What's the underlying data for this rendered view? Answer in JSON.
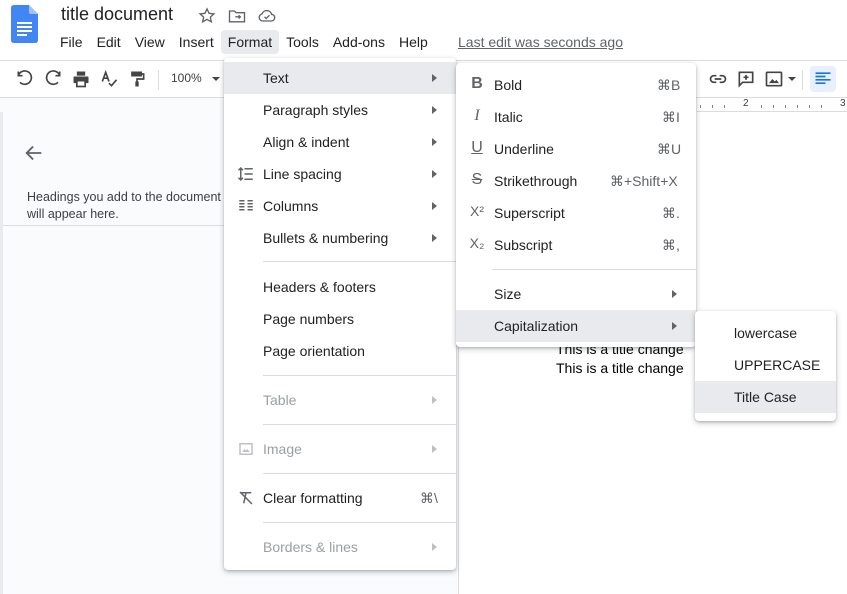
{
  "doc": {
    "title": "title document",
    "last_edit": "Last edit was seconds ago"
  },
  "menubar": [
    "File",
    "Edit",
    "View",
    "Insert",
    "Format",
    "Tools",
    "Add-ons",
    "Help"
  ],
  "toolbar": {
    "zoom": "100%"
  },
  "ruler": {
    "numbers": [
      "2",
      "3"
    ]
  },
  "outline": {
    "hint": "Headings you add to the document will appear here."
  },
  "page": {
    "lines": [
      "This is a title change",
      "This is a title change"
    ]
  },
  "format_menu": {
    "items": [
      {
        "label": "Text"
      },
      {
        "label": "Paragraph styles"
      },
      {
        "label": "Align & indent"
      },
      {
        "label": "Line spacing"
      },
      {
        "label": "Columns"
      },
      {
        "label": "Bullets & numbering"
      },
      {
        "label": "Headers & footers"
      },
      {
        "label": "Page numbers"
      },
      {
        "label": "Page orientation"
      },
      {
        "label": "Table"
      },
      {
        "label": "Image"
      },
      {
        "label": "Clear formatting",
        "shortcut": "⌘\\"
      },
      {
        "label": "Borders & lines"
      }
    ]
  },
  "text_menu": {
    "items": [
      {
        "label": "Bold",
        "shortcut": "⌘B",
        "icon": "B"
      },
      {
        "label": "Italic",
        "shortcut": "⌘I",
        "icon": "I"
      },
      {
        "label": "Underline",
        "shortcut": "⌘U",
        "icon": "U"
      },
      {
        "label": "Strikethrough",
        "shortcut": "⌘+Shift+X",
        "icon": "S"
      },
      {
        "label": "Superscript",
        "shortcut": "⌘.",
        "icon": "X²"
      },
      {
        "label": "Subscript",
        "shortcut": "⌘,",
        "icon": "X₂"
      },
      {
        "label": "Size"
      },
      {
        "label": "Capitalization"
      }
    ]
  },
  "cap_menu": {
    "items": [
      {
        "label": "lowercase"
      },
      {
        "label": "UPPERCASE"
      },
      {
        "label": "Title Case"
      }
    ]
  },
  "colors": {
    "accent": "#1a73e8",
    "docs_blue": "#4285f4"
  }
}
